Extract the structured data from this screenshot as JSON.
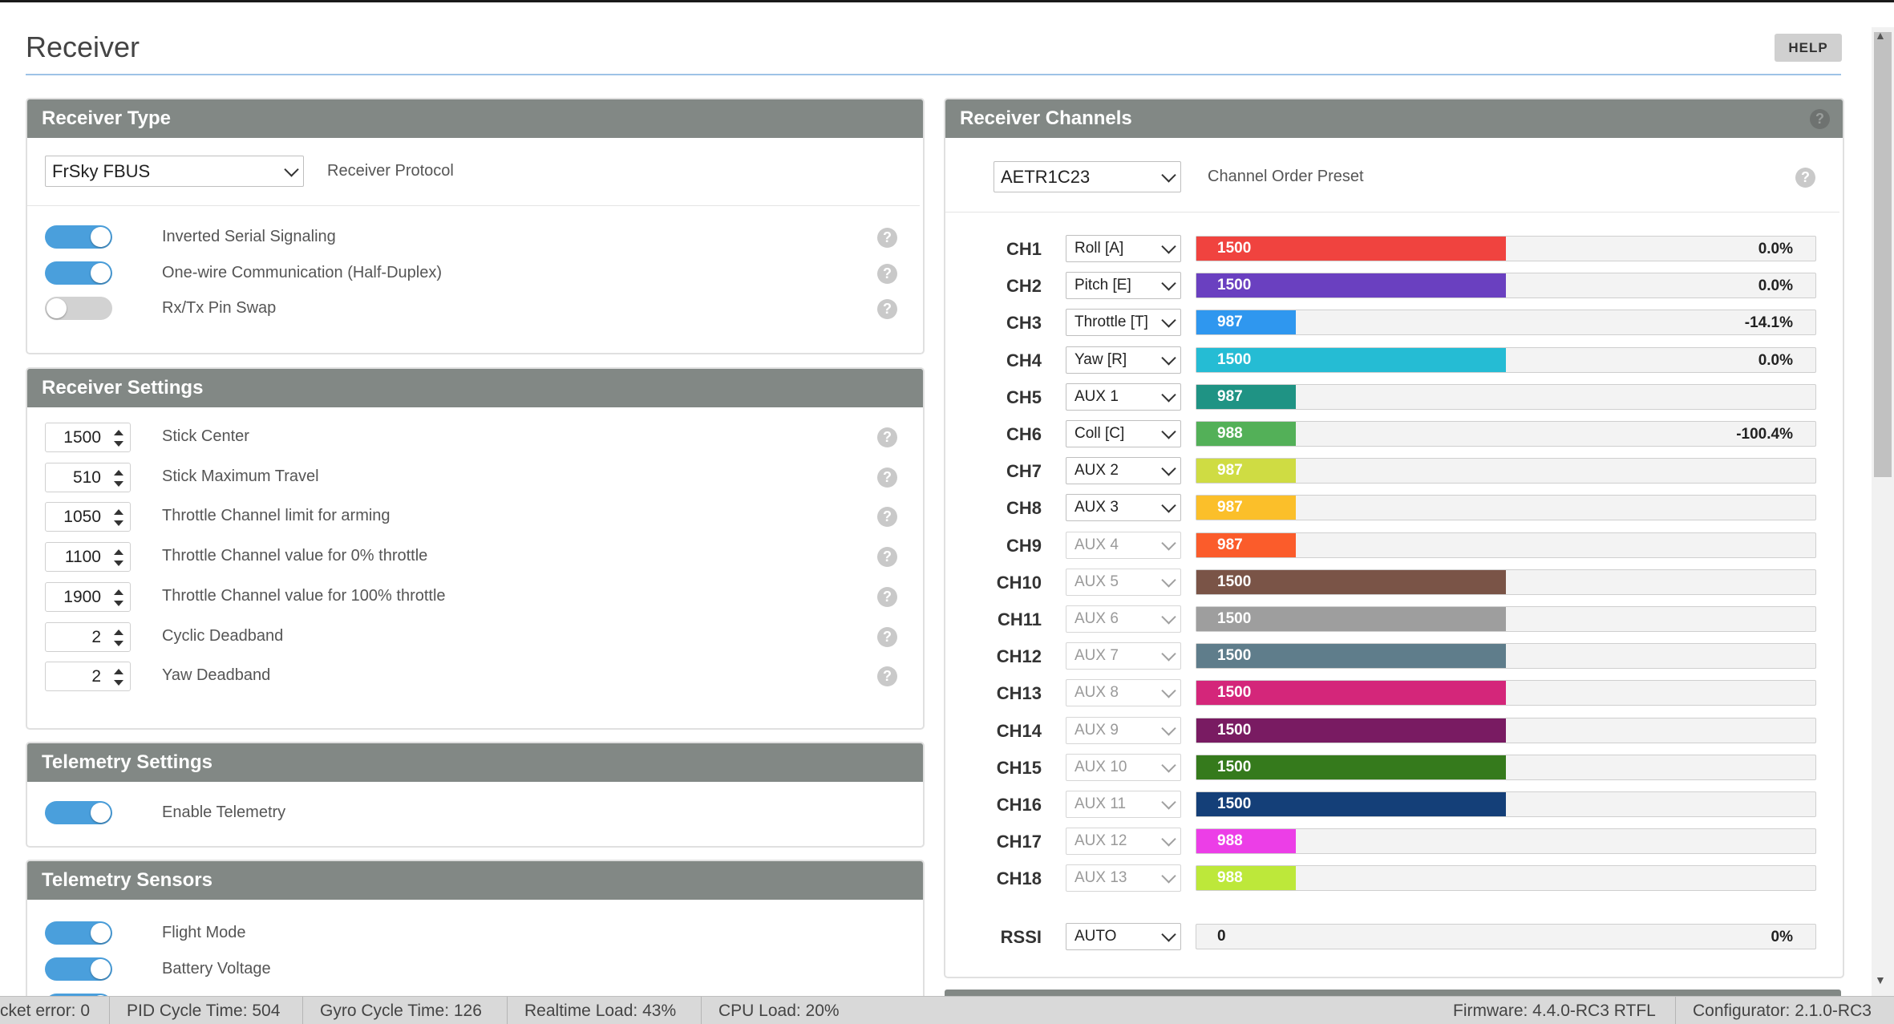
{
  "page": {
    "title": "Receiver",
    "help_label": "HELP"
  },
  "receiver_type": {
    "header": "Receiver Type",
    "protocol_value": "FrSky FBUS",
    "protocol_label": "Receiver Protocol",
    "toggles": [
      {
        "label": "Inverted Serial Signaling",
        "on": true
      },
      {
        "label": "One-wire Communication (Half-Duplex)",
        "on": true
      },
      {
        "label": "Rx/Tx Pin Swap",
        "on": false
      }
    ]
  },
  "receiver_settings": {
    "header": "Receiver Settings",
    "fields": [
      {
        "value": "1500",
        "label": "Stick Center"
      },
      {
        "value": "510",
        "label": "Stick Maximum Travel"
      },
      {
        "value": "1050",
        "label": "Throttle Channel limit for arming"
      },
      {
        "value": "1100",
        "label": "Throttle Channel value for 0% throttle"
      },
      {
        "value": "1900",
        "label": "Throttle Channel value for 100% throttle"
      },
      {
        "value": "2",
        "label": "Cyclic Deadband"
      },
      {
        "value": "2",
        "label": "Yaw Deadband"
      }
    ]
  },
  "telemetry_settings": {
    "header": "Telemetry Settings",
    "toggles": [
      {
        "label": "Enable Telemetry",
        "on": true
      }
    ]
  },
  "telemetry_sensors": {
    "header": "Telemetry Sensors",
    "toggles": [
      {
        "label": "Flight Mode",
        "on": true
      },
      {
        "label": "Battery Voltage",
        "on": true
      }
    ]
  },
  "receiver_channels": {
    "header": "Receiver Channels",
    "order_value": "AETR1C23",
    "order_label": "Channel Order Preset",
    "channels": [
      {
        "name": "CH1",
        "assign": "Roll [A]",
        "enabled": true,
        "value": "1500",
        "fill": 0.5,
        "pct": "0.0%",
        "color": "#f0433f"
      },
      {
        "name": "CH2",
        "assign": "Pitch [E]",
        "enabled": true,
        "value": "1500",
        "fill": 0.5,
        "pct": "0.0%",
        "color": "#6a40c0"
      },
      {
        "name": "CH3",
        "assign": "Throttle [T]",
        "enabled": true,
        "value": "987",
        "fill": 0.16,
        "pct": "-14.1%",
        "color": "#2f97ef"
      },
      {
        "name": "CH4",
        "assign": "Yaw [R]",
        "enabled": true,
        "value": "1500",
        "fill": 0.5,
        "pct": "0.0%",
        "color": "#25bcd4"
      },
      {
        "name": "CH5",
        "assign": "AUX 1",
        "enabled": true,
        "value": "987",
        "fill": 0.16,
        "pct": "",
        "color": "#1f9384"
      },
      {
        "name": "CH6",
        "assign": "Coll [C]",
        "enabled": true,
        "value": "988",
        "fill": 0.16,
        "pct": "-100.4%",
        "color": "#53b058"
      },
      {
        "name": "CH7",
        "assign": "AUX 2",
        "enabled": true,
        "value": "987",
        "fill": 0.16,
        "pct": "",
        "color": "#cfdc43"
      },
      {
        "name": "CH8",
        "assign": "AUX 3",
        "enabled": true,
        "value": "987",
        "fill": 0.16,
        "pct": "",
        "color": "#fbbf2a"
      },
      {
        "name": "CH9",
        "assign": "AUX 4",
        "enabled": false,
        "value": "987",
        "fill": 0.16,
        "pct": "",
        "color": "#fb5c2b"
      },
      {
        "name": "CH10",
        "assign": "AUX 5",
        "enabled": false,
        "value": "1500",
        "fill": 0.5,
        "pct": "",
        "color": "#7a5447"
      },
      {
        "name": "CH11",
        "assign": "AUX 6",
        "enabled": false,
        "value": "1500",
        "fill": 0.5,
        "pct": "",
        "color": "#9e9e9e"
      },
      {
        "name": "CH12",
        "assign": "AUX 7",
        "enabled": false,
        "value": "1500",
        "fill": 0.5,
        "pct": "",
        "color": "#5f7d8b"
      },
      {
        "name": "CH13",
        "assign": "AUX 8",
        "enabled": false,
        "value": "1500",
        "fill": 0.5,
        "pct": "",
        "color": "#d4267a"
      },
      {
        "name": "CH14",
        "assign": "AUX 9",
        "enabled": false,
        "value": "1500",
        "fill": 0.5,
        "pct": "",
        "color": "#791b62"
      },
      {
        "name": "CH15",
        "assign": "AUX 10",
        "enabled": false,
        "value": "1500",
        "fill": 0.5,
        "pct": "",
        "color": "#357a1c"
      },
      {
        "name": "CH16",
        "assign": "AUX 11",
        "enabled": false,
        "value": "1500",
        "fill": 0.5,
        "pct": "",
        "color": "#143f78"
      },
      {
        "name": "CH17",
        "assign": "AUX 12",
        "enabled": false,
        "value": "988",
        "fill": 0.16,
        "pct": "",
        "color": "#ec3ee7"
      },
      {
        "name": "CH18",
        "assign": "AUX 13",
        "enabled": false,
        "value": "988",
        "fill": 0.16,
        "pct": "",
        "color": "#bde83a"
      }
    ],
    "rssi": {
      "name": "RSSI",
      "assign": "AUTO",
      "value": "0",
      "fill": 0,
      "pct": "0%"
    }
  },
  "status_bar": {
    "packet_error": "cket error: 0",
    "pid_cycle": "PID Cycle Time: 504",
    "gyro_cycle": "Gyro Cycle Time: 126",
    "realtime_load": "Realtime Load: 43%",
    "cpu_load": "CPU Load: 20%",
    "firmware": "Firmware: 4.4.0-RC3 RTFL",
    "configurator": "Configurator: 2.1.0-RC3"
  }
}
